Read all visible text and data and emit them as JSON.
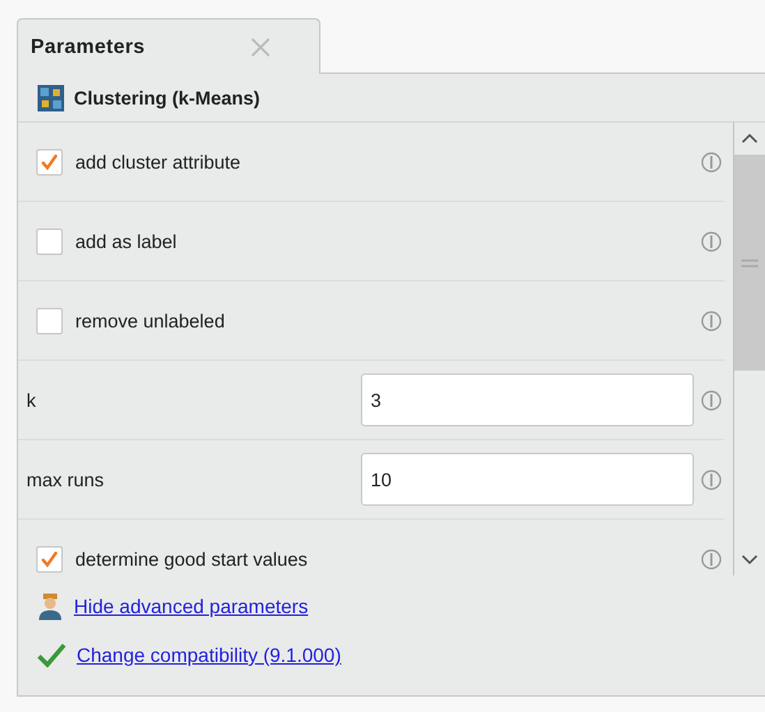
{
  "tab": {
    "label": "Parameters"
  },
  "operator": {
    "name": "Clustering (k-Means)"
  },
  "parameters": [
    {
      "kind": "checkbox",
      "label": "add cluster attribute",
      "checked": true
    },
    {
      "kind": "checkbox",
      "label": "add as label",
      "checked": false
    },
    {
      "kind": "checkbox",
      "label": "remove unlabeled",
      "checked": false
    },
    {
      "kind": "number",
      "label": "k",
      "value": "3"
    },
    {
      "kind": "number",
      "label": "max runs",
      "value": "10"
    },
    {
      "kind": "checkbox",
      "label": "determine good start values",
      "checked": true
    }
  ],
  "links": [
    {
      "kind": "advanced",
      "text": "Hide advanced parameters"
    },
    {
      "kind": "compatibility",
      "text": "Change compatibility (9.1.000)"
    }
  ]
}
